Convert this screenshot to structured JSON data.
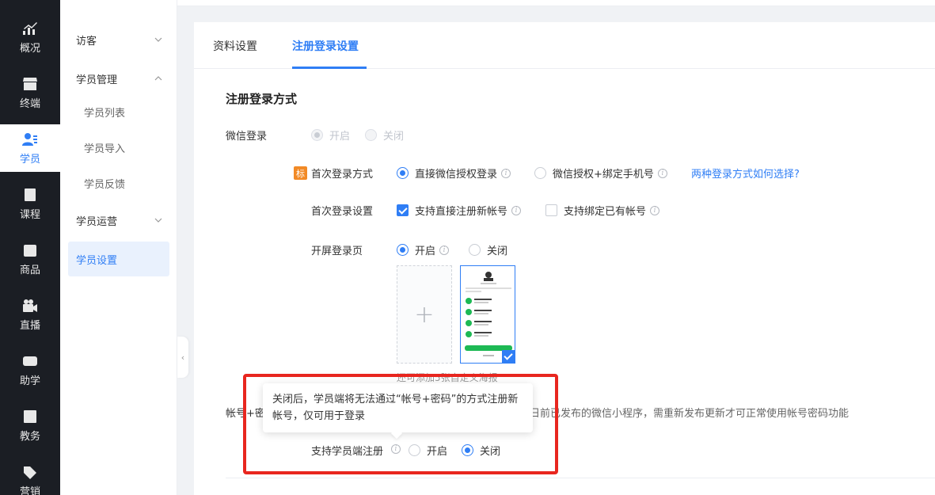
{
  "rail": {
    "items": [
      {
        "label": "概况",
        "icon": "chart-trend-icon"
      },
      {
        "label": "终端",
        "icon": "shop-icon"
      },
      {
        "label": "学员",
        "icon": "users-icon"
      },
      {
        "label": "课程",
        "icon": "book-icon"
      },
      {
        "label": "商品",
        "icon": "bag-icon"
      },
      {
        "label": "直播",
        "icon": "video-camera-icon"
      },
      {
        "label": "助学",
        "icon": "gamepad-icon"
      },
      {
        "label": "教务",
        "icon": "clipboard-icon"
      },
      {
        "label": "营销",
        "icon": "tag-icon"
      }
    ],
    "active": "学员"
  },
  "subnav": {
    "groups": [
      {
        "label": "访客",
        "expanded": false
      },
      {
        "label": "学员管理",
        "expanded": true,
        "items": [
          "学员列表",
          "学员导入",
          "学员反馈"
        ]
      },
      {
        "label": "学员运营",
        "expanded": false
      }
    ],
    "selected": "学员设置"
  },
  "tabs": [
    "资料设置",
    "注册登录设置"
  ],
  "active_tab": "注册登录设置",
  "section": {
    "title": "注册登录方式",
    "wechat_login": {
      "label": "微信登录",
      "options": [
        "开启",
        "关闭"
      ],
      "selected": "开启",
      "disabled": true
    },
    "first_login_method": {
      "badge": "标",
      "label": "首次登录方式",
      "options": [
        "直接微信授权登录",
        "微信授权+绑定手机号"
      ],
      "selected": "直接微信授权登录",
      "help_link": "两种登录方式如何选择?"
    },
    "first_login_settings": {
      "label": "首次登录设置",
      "options": [
        {
          "label": "支持直接注册新帐号",
          "checked": true
        },
        {
          "label": "支持绑定已有帐号",
          "checked": false
        }
      ]
    },
    "splash_login": {
      "label": "开屏登录页",
      "options": [
        "开启",
        "关闭"
      ],
      "selected": "开启",
      "upload_hint": "还可添加5张自定义海报"
    },
    "account_password": {
      "label": "帐号+密",
      "notice": "日前已发布的微信小程序，需重新发布更新才可正常使用帐号密码功能",
      "tooltip": "关闭后，学员端将无法通过“帐号+密码”的方式注册新帐号，仅可用于登录",
      "register_label": "支持学员端注册",
      "options": [
        "开启",
        "关闭"
      ],
      "selected": "关闭"
    }
  },
  "colors": {
    "accent": "#2f7ef5",
    "rail_bg": "#1b1e24",
    "highlight_box": "#e8261f",
    "badge": "#f28a26"
  }
}
